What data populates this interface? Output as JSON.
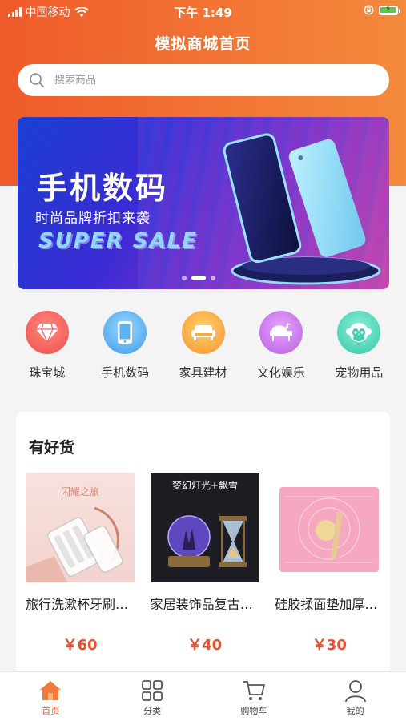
{
  "status_bar": {
    "carrier": "中国移动",
    "time": "下午 1:49"
  },
  "header": {
    "title": "模拟商城首页"
  },
  "search": {
    "placeholder": "搜索商品"
  },
  "banner": {
    "title": "手机数码",
    "subtitle": "时尚品牌折扣来袭",
    "tagline": "SUPER SALE",
    "slide_count": 3,
    "active_slide": 2
  },
  "categories": [
    {
      "label": "珠宝城",
      "icon": "diamond-icon",
      "color": "#f05b5b"
    },
    {
      "label": "手机数码",
      "icon": "phone-icon",
      "color": "#4aa8ef"
    },
    {
      "label": "家具建材",
      "icon": "sofa-icon",
      "color": "#f7a43a"
    },
    {
      "label": "文化娱乐",
      "icon": "piano-icon",
      "color": "#c46ee8"
    },
    {
      "label": "宠物用品",
      "icon": "monkey-icon",
      "color": "#4fd1b4"
    }
  ],
  "goods": {
    "title": "有好货",
    "items": [
      {
        "name": "旅行洗漱杯牙刷收纳盒",
        "price": "￥60",
        "image_text": "闪耀之旅"
      },
      {
        "name": "家居装饰品复古摆件",
        "price": "￥40",
        "image_text": "梦幻灯光+飘雪"
      },
      {
        "name": "硅胶揉面垫加厚案板",
        "price": "￥30",
        "image_text": ""
      }
    ]
  },
  "tabbar": {
    "items": [
      {
        "label": "首页",
        "icon": "home-icon",
        "active": true
      },
      {
        "label": "分类",
        "icon": "grid-icon",
        "active": false
      },
      {
        "label": "购物车",
        "icon": "cart-icon",
        "active": false
      },
      {
        "label": "我的",
        "icon": "user-icon",
        "active": false
      }
    ]
  },
  "colors": {
    "brand": "#ef5a2a",
    "price": "#ef4d2a"
  }
}
